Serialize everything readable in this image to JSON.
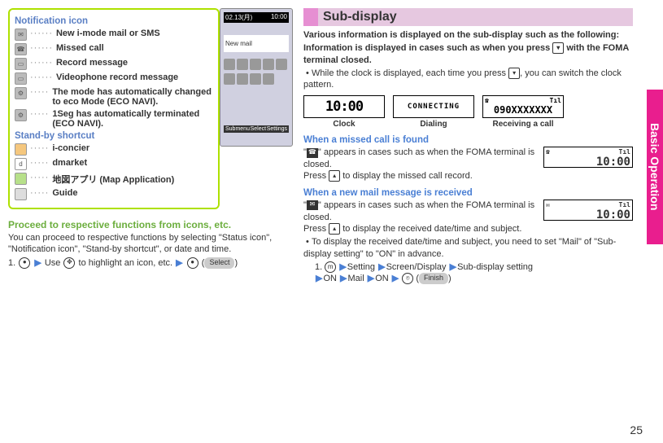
{
  "tab": "Basic Operation",
  "page_number": "25",
  "left": {
    "section_notification_title": "Notification icon",
    "notifications": [
      {
        "label": "New i-mode mail or SMS"
      },
      {
        "label": "Missed call"
      },
      {
        "label": "Record message"
      },
      {
        "label": "Videophone record message"
      },
      {
        "label": "The mode has automatically changed to eco Mode (ECO NAVI)."
      },
      {
        "label": "1Seg has automatically terminated (ECO NAVI)."
      }
    ],
    "section_standby_title": "Stand-by shortcut",
    "standby": [
      {
        "label": "i-concier"
      },
      {
        "label": "dmarket"
      },
      {
        "label": "地図アプリ (Map Application)"
      },
      {
        "label": "Guide"
      }
    ],
    "proceed_heading": "Proceed to respective functions from icons, etc.",
    "proceed_text": "You can proceed to respective functions by selecting \"Status icon\", \"Notification icon\", \"Stand-by shortcut\", or date and time.",
    "proceed_step_prefix": "1.",
    "proceed_step_use": "Use",
    "proceed_step_tail": "to highlight an icon, etc.",
    "select_pill": "Select"
  },
  "phone": {
    "date": "02.13(月)",
    "clock": "10:00",
    "banner": "New mail",
    "sub_left": "Submenu",
    "sub_mid": "Select",
    "sub_right": "Settings"
  },
  "right": {
    "header": "Sub-display",
    "intro1": "Various information is displayed on the sub-display such as the following:",
    "intro2": "Information is displayed in cases such as when you press",
    "intro2_tail": "with the FOMA terminal closed.",
    "bullet1_a": "While the clock is displayed, each time you press",
    "bullet1_b": ", you can switch the clock pattern.",
    "lcd_clock": "10:00",
    "lcd_dialing": "CONNECTING",
    "lcd_receiving": "090XXXXXXX",
    "label_clock": "Clock",
    "label_dialing": "Dialing",
    "label_receiving": "Receiving a call",
    "missed_heading": "When a missed call is found",
    "missed_text_a": "\"",
    "missed_text_b": "\" appears in cases such as when the FOMA terminal is closed.",
    "missed_text_c": "Press",
    "missed_text_d": "to display the missed call record.",
    "newmail_heading": "When a new mail message is received",
    "newmail_text_a": "\"",
    "newmail_text_b": "\" appears in cases such as when the FOMA terminal is closed.",
    "newmail_text_c": "Press",
    "newmail_text_d": "to display the received date/time and subject.",
    "newmail_note": "To display the received date/time and subject, you need to set \"Mail\" of \"Sub-display setting\" to \"ON\" in advance.",
    "path_1": "1.",
    "path_setting": "Setting",
    "path_screen": "Screen/Display",
    "path_sub": "Sub-display setting",
    "path_on1": "ON",
    "path_mail": "Mail",
    "path_on2": "ON",
    "finish_pill": "Finish",
    "sub_lcd_clock": "10:00",
    "icon_signal": "Tıl"
  }
}
